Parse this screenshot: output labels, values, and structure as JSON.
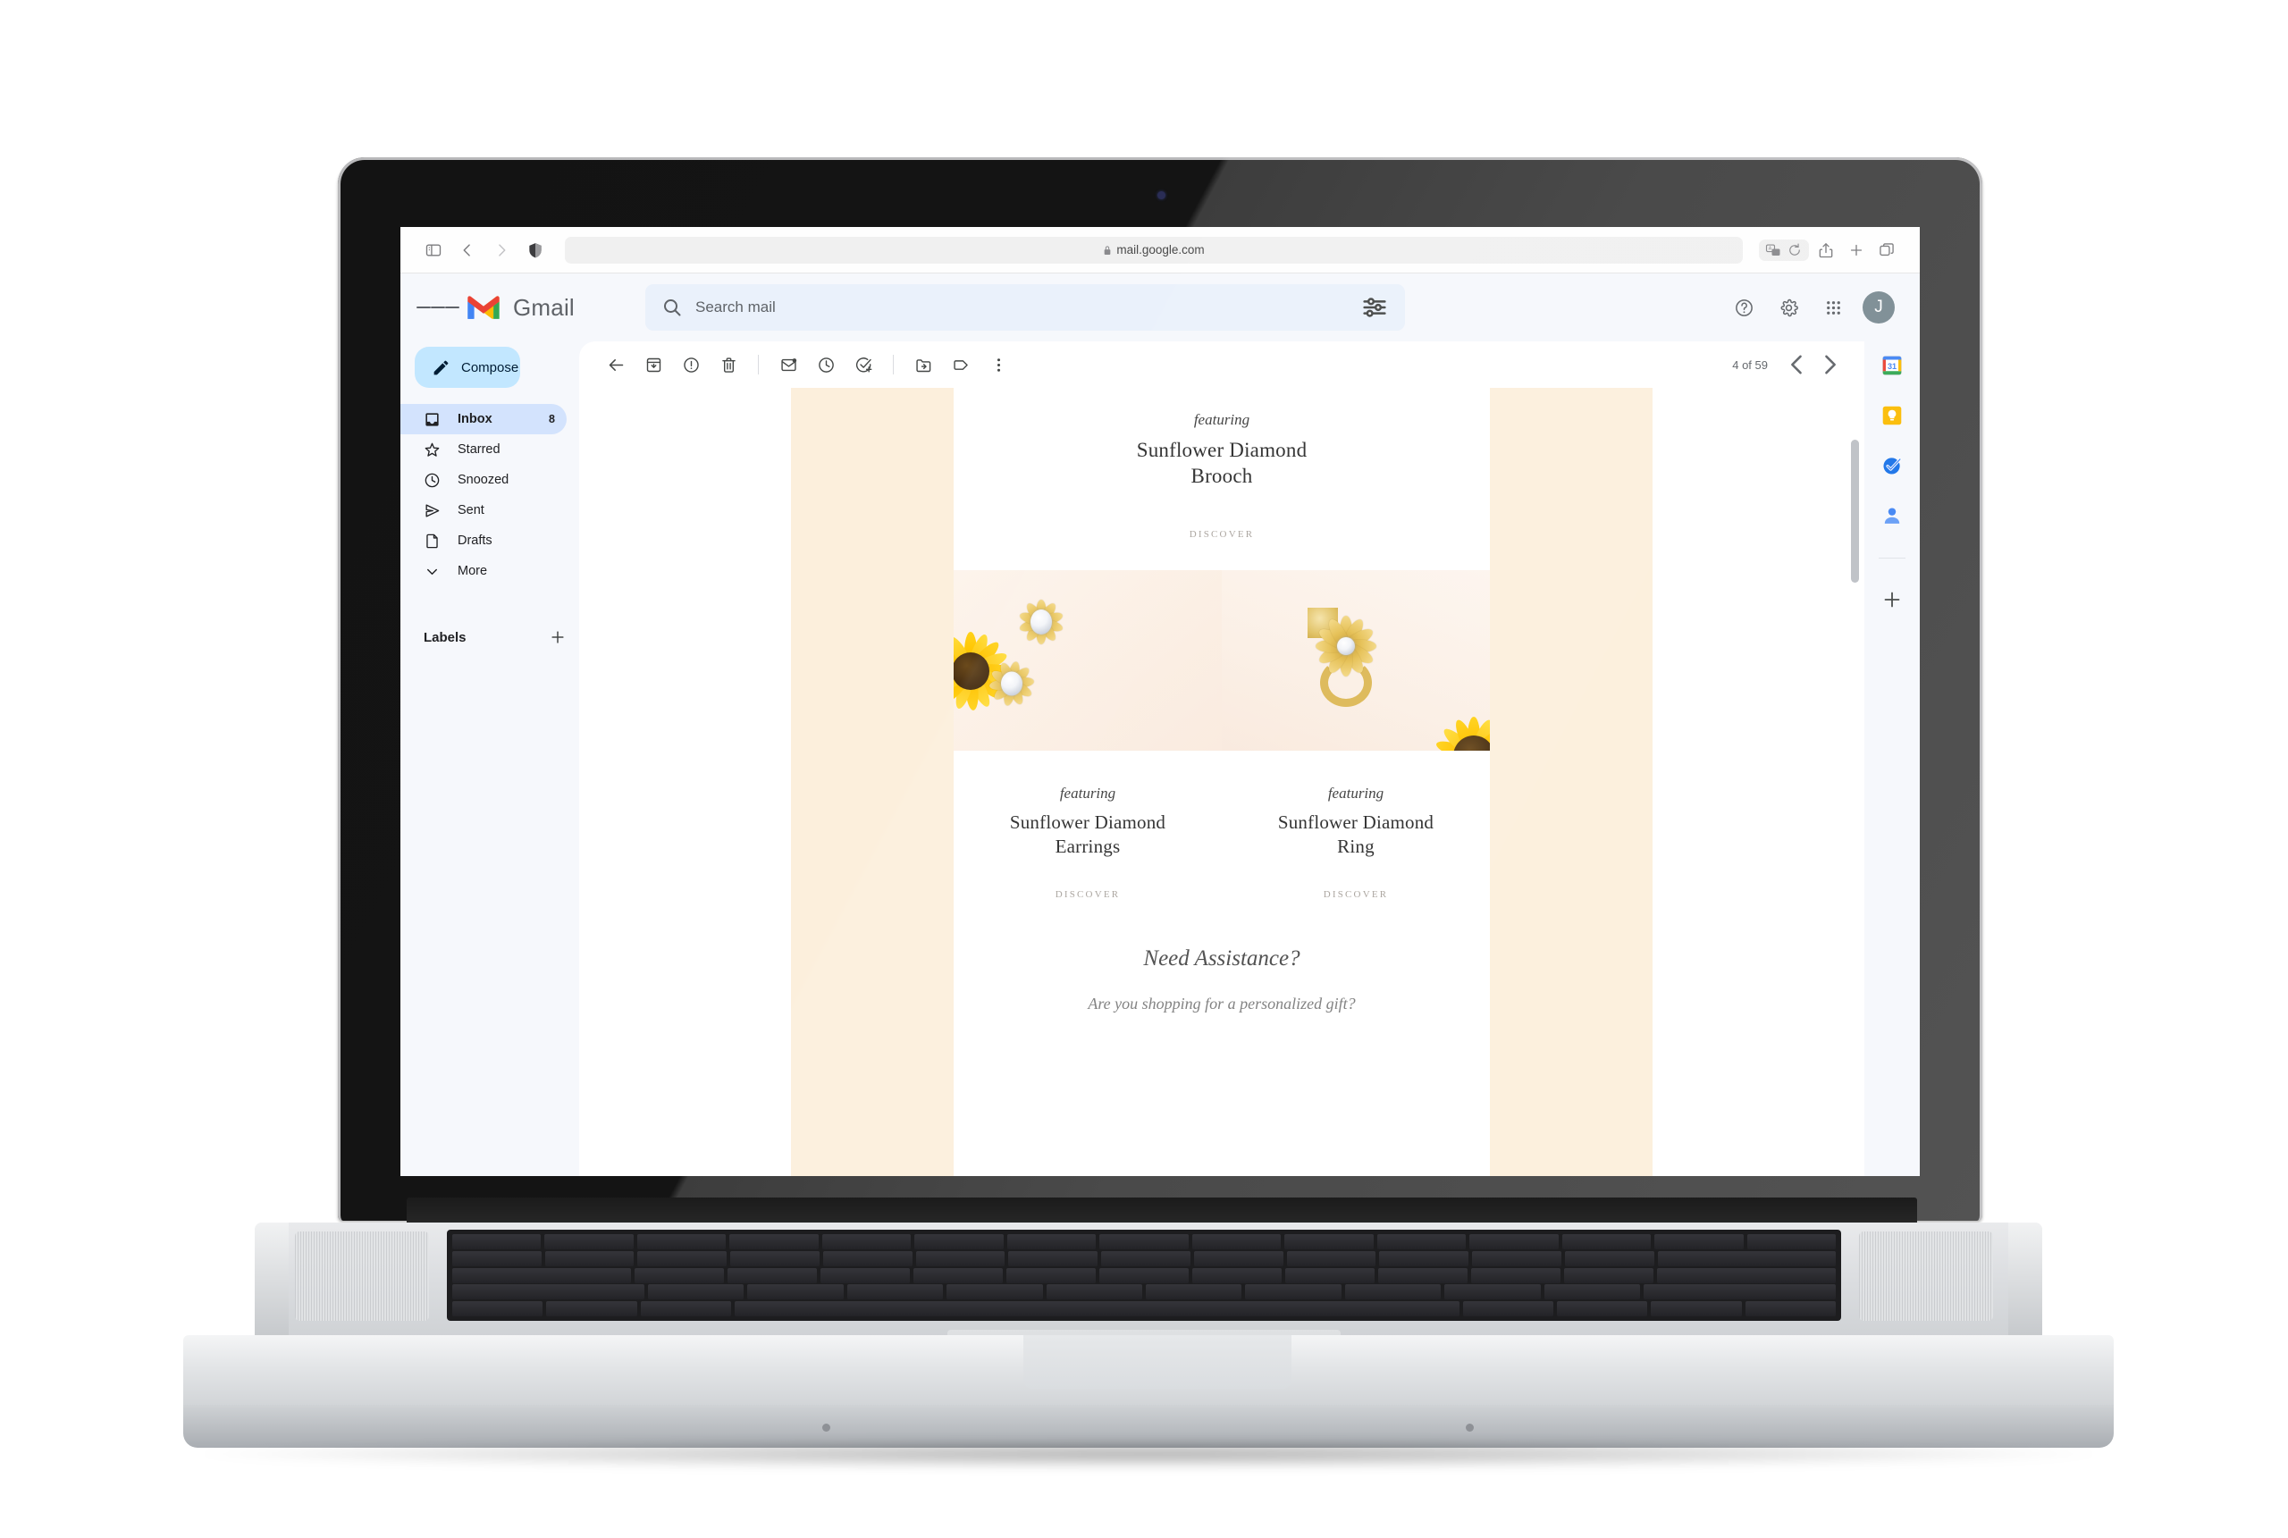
{
  "browser": {
    "url": "mail.google.com",
    "icons": {
      "sidebar_toggle": "sidebar-toggle-icon",
      "back": "back-icon",
      "forward": "forward-icon",
      "shield": "shield-icon",
      "lock": "lock-icon",
      "translate": "translate-icon",
      "reload": "reload-icon",
      "share": "share-icon",
      "new_tab": "plus-icon",
      "tabs": "tabs-overview-icon"
    }
  },
  "gmail": {
    "app_name": "Gmail",
    "search": {
      "placeholder": "Search mail",
      "value": ""
    },
    "header_icons": [
      "help-icon",
      "settings-gear-icon",
      "google-apps-grid-icon"
    ],
    "avatar_letter": "J",
    "sidebar": {
      "compose_label": "Compose",
      "items": [
        {
          "label": "Inbox",
          "icon": "inbox-icon",
          "count": "8",
          "active": true
        },
        {
          "label": "Starred",
          "icon": "star-icon",
          "count": "",
          "active": false
        },
        {
          "label": "Snoozed",
          "icon": "clock-icon",
          "count": "",
          "active": false
        },
        {
          "label": "Sent",
          "icon": "send-icon",
          "count": "",
          "active": false
        },
        {
          "label": "Drafts",
          "icon": "draft-icon",
          "count": "",
          "active": false
        },
        {
          "label": "More",
          "icon": "chevron-down-icon",
          "count": "",
          "active": false
        }
      ],
      "labels_heading": "Labels",
      "add_label": "+"
    },
    "toolbar": {
      "back": "back-to-inbox",
      "archive": "archive-icon",
      "report_spam": "report-spam-icon",
      "delete": "delete-icon",
      "mark_unread": "mark-unread-icon",
      "snooze": "snooze-icon",
      "add_to_tasks": "add-to-tasks-icon",
      "move_to": "move-to-icon",
      "labels": "label-icon",
      "more": "more-options-icon",
      "pagination": "4 of 59",
      "prev": "newer-icon",
      "next": "older-icon"
    },
    "right_rail": {
      "items": [
        "google-calendar-icon",
        "google-keep-icon",
        "google-tasks-icon",
        "google-contacts-icon"
      ],
      "add": "+"
    },
    "next_email_arrow": "next-email-icon"
  },
  "email": {
    "hero": {
      "featuring": "featuring",
      "title_line1": "Sunflower Diamond",
      "title_line2": "Brooch",
      "cta": "DISCOVER"
    },
    "products": [
      {
        "featuring": "featuring",
        "title_line1": "Sunflower Diamond",
        "title_line2": "Earrings",
        "cta": "DISCOVER"
      },
      {
        "featuring": "featuring",
        "title_line1": "Sunflower Diamond",
        "title_line2": "Ring",
        "cta": "DISCOVER"
      }
    ],
    "assistance": {
      "heading": "Need Assistance?",
      "subtext": "Are you shopping for a personalized gift?"
    },
    "colors": {
      "band": "#FCEFDC",
      "photo_bg": "#FBF0E6",
      "gold": "#E5BF52",
      "petal": "#FFC400"
    }
  }
}
